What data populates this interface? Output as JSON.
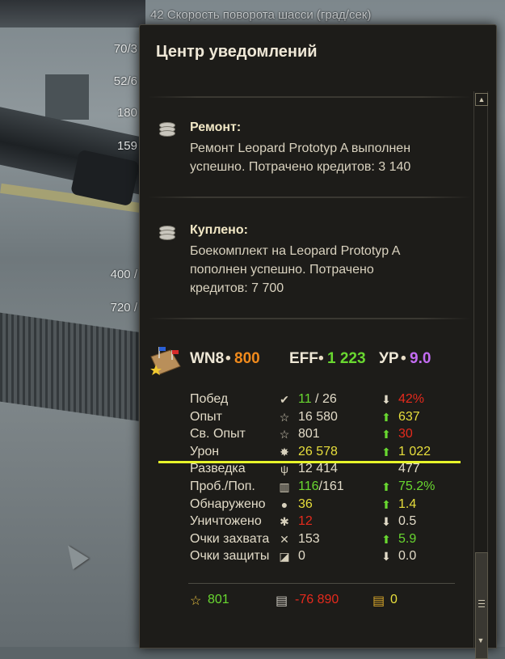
{
  "background": {
    "top_label": "42  Скорость поворота шасси (град/сек)",
    "side_numbers": [
      "70/3",
      "52/6",
      "180",
      "159",
      "400 /",
      "720 /"
    ]
  },
  "panel": {
    "title": "Центр уведомлений",
    "notifications": [
      {
        "title": "Ремонт:",
        "lines": [
          "Ремонт Leopard Prototyp A выполнен",
          "успешно. Потрачено кредитов:  3 140"
        ],
        "icon": "credits-icon"
      },
      {
        "title": "Куплено:",
        "lines": [
          "Боекомплект на Leopard Prototyp A",
          "пополнен успешно. Потрачено",
          "кредитов:  7 700"
        ],
        "icon": "credits-icon"
      }
    ],
    "ratings": {
      "wn8_label": "WN8",
      "wn8_value": "800",
      "eff_label": "EFF",
      "eff_value": "1 223",
      "ur_label": "УР",
      "ur_value": "9.0",
      "dot": "•"
    },
    "stats": [
      {
        "label": "Побед",
        "icon": "check-icon",
        "glyph": "✔",
        "value": "11",
        "value_extra": " / 26",
        "value_color": "green",
        "trend": "down",
        "trend_value": "42%",
        "trend_color": "red"
      },
      {
        "label": "Опыт",
        "icon": "star-outline-icon",
        "glyph": "☆",
        "value": "16 580",
        "value_extra": "",
        "value_color": "white",
        "trend": "up",
        "trend_value": "637",
        "trend_color": "yellow"
      },
      {
        "label": "Св. Опыт",
        "icon": "free-xp-star-icon",
        "glyph": "☆",
        "value": "801",
        "value_extra": "",
        "value_color": "white",
        "trend": "up",
        "trend_value": "30",
        "trend_color": "red"
      },
      {
        "label": "Урон",
        "icon": "damage-icon",
        "glyph": "✸",
        "value": "26 578",
        "value_extra": "",
        "value_color": "yellow",
        "trend": "up",
        "trend_value": "1 022",
        "trend_color": "yellow"
      },
      {
        "label": "Разведка",
        "icon": "spotting-icon",
        "glyph": "ψ",
        "value": "12 414",
        "value_extra": "",
        "value_color": "white",
        "trend": "none",
        "trend_value": "477",
        "trend_color": "white"
      },
      {
        "label": "Проб./Поп.",
        "icon": "penetration-icon",
        "glyph": "▥",
        "value": "116",
        "value_extra": "/161",
        "value_color": "green",
        "trend": "up",
        "trend_value": "75.2%",
        "trend_color": "green"
      },
      {
        "label": "Обнаружено",
        "icon": "detected-icon",
        "glyph": "●",
        "value": "36",
        "value_extra": "",
        "value_color": "yellow",
        "trend": "up",
        "trend_value": "1.4",
        "trend_color": "yellow"
      },
      {
        "label": "Уничтожено",
        "icon": "destroyed-icon",
        "glyph": "✱",
        "value": "12",
        "value_extra": "",
        "value_color": "red",
        "trend": "down",
        "trend_value": "0.5",
        "trend_color": "white"
      },
      {
        "label": "Очки захвата",
        "icon": "capture-icon",
        "glyph": "✕",
        "value": "153",
        "value_extra": "",
        "value_color": "white",
        "trend": "up",
        "trend_value": "5.9",
        "trend_color": "green"
      },
      {
        "label": "Очки защиты",
        "icon": "defense-icon",
        "glyph": "◪",
        "value": "0",
        "value_extra": "",
        "value_color": "white",
        "trend": "down",
        "trend_value": "0.0",
        "trend_color": "white"
      }
    ],
    "footer": {
      "xp_value": "801",
      "credits_value": "-76 890",
      "gold_value": "0"
    }
  },
  "colors": {
    "green": "#69d830",
    "red": "#e52a1d",
    "yellow": "#e8df3c",
    "orange": "#f08a1c",
    "purple": "#c36cf2",
    "highlight": "#e7f52a"
  }
}
